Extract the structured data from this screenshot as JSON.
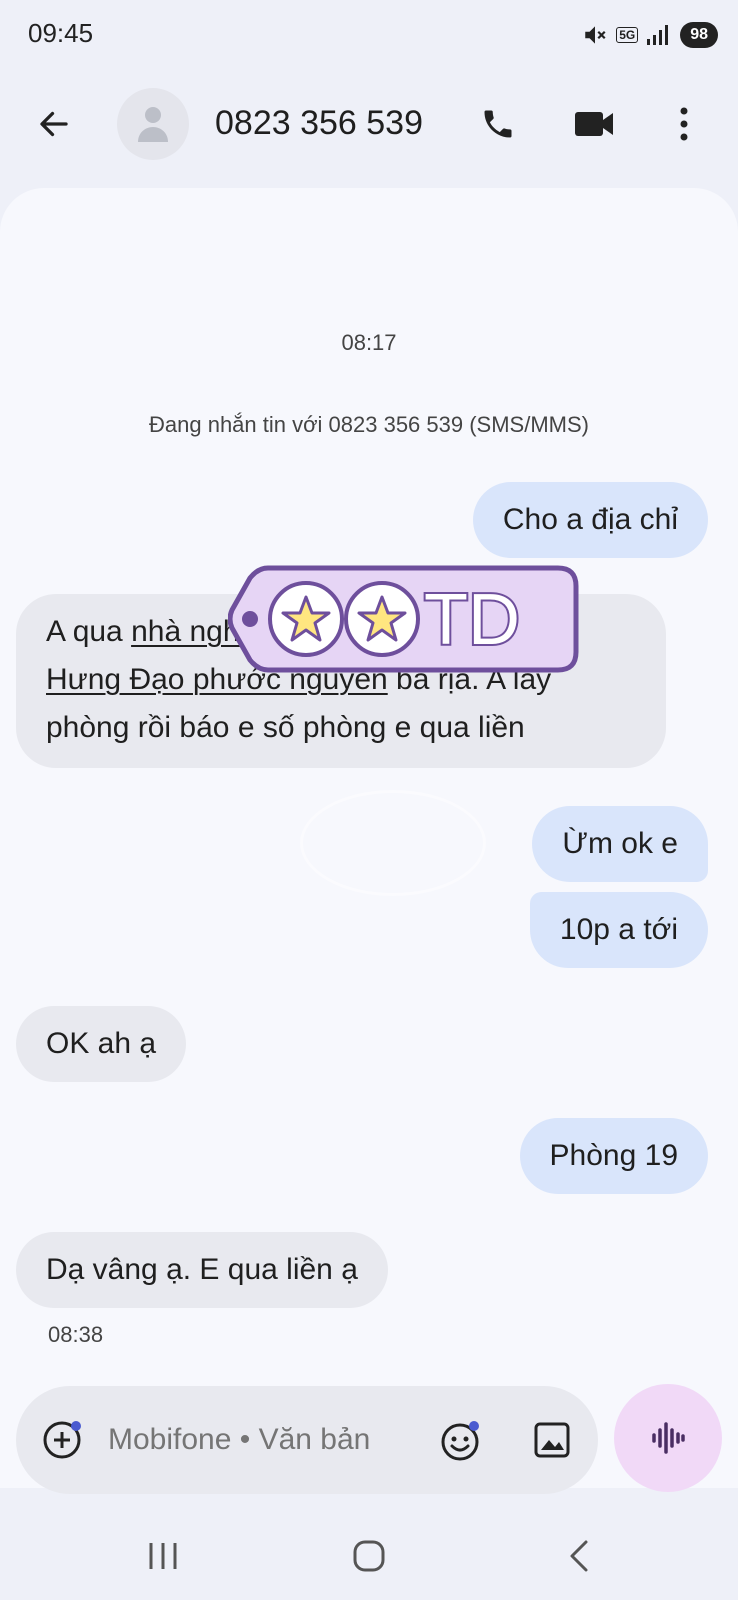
{
  "status_bar": {
    "time": "09:45",
    "network": "5G",
    "battery": "98"
  },
  "app_bar": {
    "contact": "0823 356 539",
    "icons": [
      "back-arrow-icon",
      "avatar-person-icon",
      "phone-icon",
      "video-camera-icon",
      "more-vert-icon"
    ]
  },
  "conversation": {
    "first_timestamp": "08:17",
    "info": "Đang nhắn tin với 0823 356 539 (SMS/MMS)",
    "messages": [
      {
        "direction": "outgoing",
        "text": "Cho a địa chỉ"
      },
      {
        "direction": "incoming",
        "text_parts": {
          "p1": "A qua ",
          "link1": "nhà ngh",
          "sticker_gap": "",
          "link2": "Hưng Đạo phước nguyên",
          "p2": " ba rịa. A lấy",
          "p3": "phòng rồi báo e số phòng e qua liền"
        }
      },
      {
        "direction": "outgoing",
        "text": "Ừm ok e"
      },
      {
        "direction": "outgoing",
        "text": "10p a tới"
      },
      {
        "direction": "incoming",
        "text": "OK ah ạ"
      },
      {
        "direction": "outgoing",
        "text": "Phòng 19"
      },
      {
        "direction": "incoming",
        "text": "Dạ vâng ạ. E qua liền ạ"
      }
    ],
    "last_timestamp": "08:38"
  },
  "sticker": {
    "text": "TD",
    "colors": {
      "outline": "#7a5aa8",
      "fill": "#e6d5f5",
      "star": "#ffe680"
    }
  },
  "composer": {
    "placeholder": "Mobifone • Văn bản",
    "icons": [
      "add-icon",
      "emoji-icon",
      "gallery-icon",
      "voice-icon"
    ]
  },
  "colors": {
    "outgoing_bubble": "#d9e5fb",
    "incoming_bubble": "#e8e9ef",
    "panel": "#f7f8fd",
    "background": "#eef0f8",
    "voice_button": "#f1d9f7",
    "voice_icon": "#4a2e63"
  },
  "nav_bar": {
    "icons": [
      "recents-icon",
      "home-icon",
      "back-icon"
    ]
  }
}
